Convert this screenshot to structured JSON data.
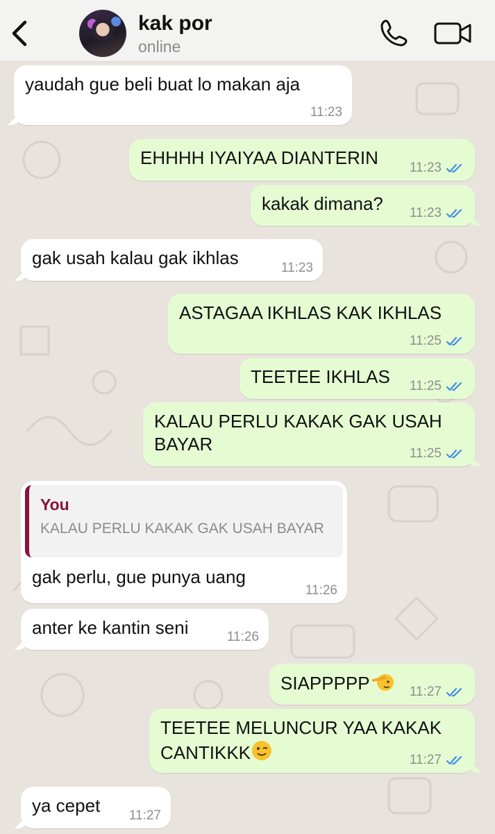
{
  "header": {
    "back_icon": "chevron-left-icon",
    "contact_name": "kak por",
    "status": "online",
    "call_icon": "phone-icon",
    "video_icon": "video-camera-icon"
  },
  "colors": {
    "incoming_bubble": "#ffffff",
    "outgoing_bubble": "#e5fcd3",
    "read_ticks": "#3e8ee6",
    "quote_accent": "#8a1238",
    "wallpaper": "#e9e3dd"
  },
  "messages": [
    {
      "text": "yaudah gue beli buat lo makan aja",
      "time": "11:23"
    },
    {
      "text": "EHHHH IYAIYAA DIANTERIN",
      "time": "11:23"
    },
    {
      "text": "kakak dimana?",
      "time": "11:23"
    },
    {
      "text": "gak usah kalau gak ikhlas",
      "time": "11:23"
    },
    {
      "text": "ASTAGAA IKHLAS KAK IKHLAS",
      "time": "11:25"
    },
    {
      "text": "TEETEE IKHLAS",
      "time": "11:25"
    },
    {
      "text": "KALAU PERLU KAKAK GAK USAH\nBAYAR",
      "time": "11:25"
    },
    {
      "quote_author": "You",
      "quote_text": "KALAU PERLU KAKAK GAK USAH BAYAR",
      "text": "gak perlu, gue punya uang",
      "time": "11:26"
    },
    {
      "text": "anter ke kantin seni",
      "time": "11:26"
    },
    {
      "text": "SIAPPPPP",
      "emoji": "saluting-face-emoji",
      "time": "11:27"
    },
    {
      "text": "TEETEE MELUNCUR YAA KAKAK\nCANTIKKK",
      "emoji": "winking-face-emoji",
      "time": "11:27"
    },
    {
      "text": "ya cepet",
      "time": "11:27"
    }
  ]
}
